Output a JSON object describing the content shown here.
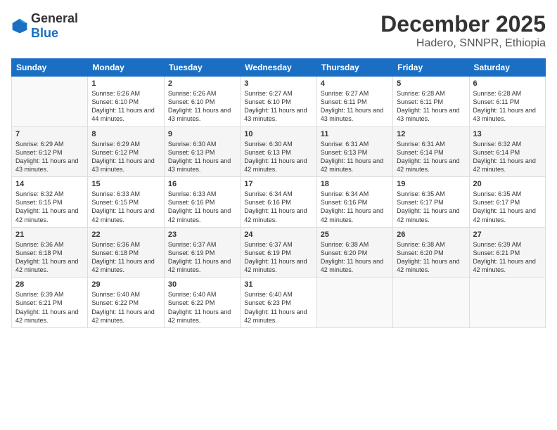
{
  "logo": {
    "general": "General",
    "blue": "Blue"
  },
  "title": "December 2025",
  "location": "Hadero, SNNPR, Ethiopia",
  "days_of_week": [
    "Sunday",
    "Monday",
    "Tuesday",
    "Wednesday",
    "Thursday",
    "Friday",
    "Saturday"
  ],
  "weeks": [
    [
      {
        "day": "",
        "info": ""
      },
      {
        "day": "1",
        "info": "Sunrise: 6:26 AM\nSunset: 6:10 PM\nDaylight: 11 hours\nand 44 minutes."
      },
      {
        "day": "2",
        "info": "Sunrise: 6:26 AM\nSunset: 6:10 PM\nDaylight: 11 hours\nand 43 minutes."
      },
      {
        "day": "3",
        "info": "Sunrise: 6:27 AM\nSunset: 6:10 PM\nDaylight: 11 hours\nand 43 minutes."
      },
      {
        "day": "4",
        "info": "Sunrise: 6:27 AM\nSunset: 6:11 PM\nDaylight: 11 hours\nand 43 minutes."
      },
      {
        "day": "5",
        "info": "Sunrise: 6:28 AM\nSunset: 6:11 PM\nDaylight: 11 hours\nand 43 minutes."
      },
      {
        "day": "6",
        "info": "Sunrise: 6:28 AM\nSunset: 6:11 PM\nDaylight: 11 hours\nand 43 minutes."
      }
    ],
    [
      {
        "day": "7",
        "info": "Sunrise: 6:29 AM\nSunset: 6:12 PM\nDaylight: 11 hours\nand 43 minutes."
      },
      {
        "day": "8",
        "info": "Sunrise: 6:29 AM\nSunset: 6:12 PM\nDaylight: 11 hours\nand 43 minutes."
      },
      {
        "day": "9",
        "info": "Sunrise: 6:30 AM\nSunset: 6:13 PM\nDaylight: 11 hours\nand 43 minutes."
      },
      {
        "day": "10",
        "info": "Sunrise: 6:30 AM\nSunset: 6:13 PM\nDaylight: 11 hours\nand 42 minutes."
      },
      {
        "day": "11",
        "info": "Sunrise: 6:31 AM\nSunset: 6:13 PM\nDaylight: 11 hours\nand 42 minutes."
      },
      {
        "day": "12",
        "info": "Sunrise: 6:31 AM\nSunset: 6:14 PM\nDaylight: 11 hours\nand 42 minutes."
      },
      {
        "day": "13",
        "info": "Sunrise: 6:32 AM\nSunset: 6:14 PM\nDaylight: 11 hours\nand 42 minutes."
      }
    ],
    [
      {
        "day": "14",
        "info": "Sunrise: 6:32 AM\nSunset: 6:15 PM\nDaylight: 11 hours\nand 42 minutes."
      },
      {
        "day": "15",
        "info": "Sunrise: 6:33 AM\nSunset: 6:15 PM\nDaylight: 11 hours\nand 42 minutes."
      },
      {
        "day": "16",
        "info": "Sunrise: 6:33 AM\nSunset: 6:16 PM\nDaylight: 11 hours\nand 42 minutes."
      },
      {
        "day": "17",
        "info": "Sunrise: 6:34 AM\nSunset: 6:16 PM\nDaylight: 11 hours\nand 42 minutes."
      },
      {
        "day": "18",
        "info": "Sunrise: 6:34 AM\nSunset: 6:16 PM\nDaylight: 11 hours\nand 42 minutes."
      },
      {
        "day": "19",
        "info": "Sunrise: 6:35 AM\nSunset: 6:17 PM\nDaylight: 11 hours\nand 42 minutes."
      },
      {
        "day": "20",
        "info": "Sunrise: 6:35 AM\nSunset: 6:17 PM\nDaylight: 11 hours\nand 42 minutes."
      }
    ],
    [
      {
        "day": "21",
        "info": "Sunrise: 6:36 AM\nSunset: 6:18 PM\nDaylight: 11 hours\nand 42 minutes."
      },
      {
        "day": "22",
        "info": "Sunrise: 6:36 AM\nSunset: 6:18 PM\nDaylight: 11 hours\nand 42 minutes."
      },
      {
        "day": "23",
        "info": "Sunrise: 6:37 AM\nSunset: 6:19 PM\nDaylight: 11 hours\nand 42 minutes."
      },
      {
        "day": "24",
        "info": "Sunrise: 6:37 AM\nSunset: 6:19 PM\nDaylight: 11 hours\nand 42 minutes."
      },
      {
        "day": "25",
        "info": "Sunrise: 6:38 AM\nSunset: 6:20 PM\nDaylight: 11 hours\nand 42 minutes."
      },
      {
        "day": "26",
        "info": "Sunrise: 6:38 AM\nSunset: 6:20 PM\nDaylight: 11 hours\nand 42 minutes."
      },
      {
        "day": "27",
        "info": "Sunrise: 6:39 AM\nSunset: 6:21 PM\nDaylight: 11 hours\nand 42 minutes."
      }
    ],
    [
      {
        "day": "28",
        "info": "Sunrise: 6:39 AM\nSunset: 6:21 PM\nDaylight: 11 hours\nand 42 minutes."
      },
      {
        "day": "29",
        "info": "Sunrise: 6:40 AM\nSunset: 6:22 PM\nDaylight: 11 hours\nand 42 minutes."
      },
      {
        "day": "30",
        "info": "Sunrise: 6:40 AM\nSunset: 6:22 PM\nDaylight: 11 hours\nand 42 minutes."
      },
      {
        "day": "31",
        "info": "Sunrise: 6:40 AM\nSunset: 6:23 PM\nDaylight: 11 hours\nand 42 minutes."
      },
      {
        "day": "",
        "info": ""
      },
      {
        "day": "",
        "info": ""
      },
      {
        "day": "",
        "info": ""
      }
    ]
  ]
}
